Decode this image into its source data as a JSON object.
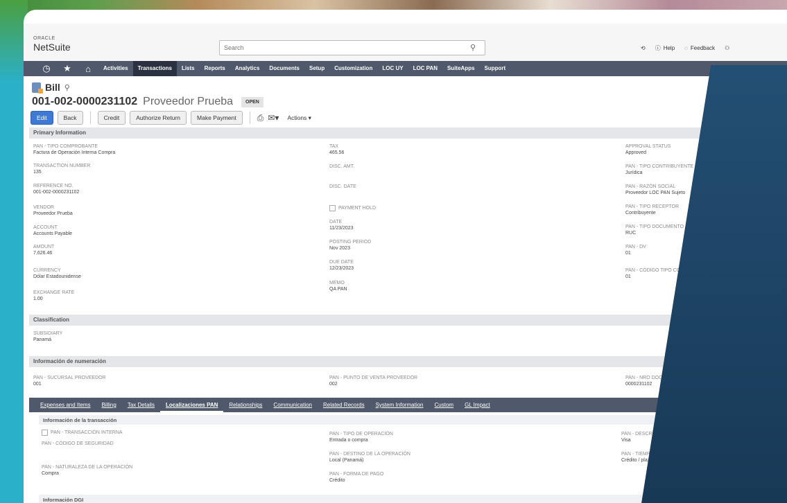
{
  "header": {
    "logo_small": "ORACLE",
    "logo_main": "NetSuite",
    "search_placeholder": "Search",
    "help": "Help",
    "feedback": "Feedback"
  },
  "nav": {
    "items": [
      "Activities",
      "Transactions",
      "Lists",
      "Reports",
      "Analytics",
      "Documents",
      "Setup",
      "Customization",
      "LOC UY",
      "LOC PAN",
      "SuiteApps",
      "Support"
    ],
    "active": "Transactions"
  },
  "record": {
    "type": "Bill",
    "number": "001-002-0000231102",
    "vendor_name": "Proveedor Prueba",
    "status": "OPEN"
  },
  "buttons": {
    "edit": "Edit",
    "back": "Back",
    "credit": "Credit",
    "authorize_return": "Authorize Return",
    "make_payment": "Make Payment",
    "actions": "Actions ▾"
  },
  "primary": {
    "title": "Primary Information",
    "col1": [
      {
        "label": "PAN - TIPO COMPROBANTE",
        "value": "Factura de Operación Interna Compra"
      },
      {
        "label": "TRANSACTION NUMBER",
        "value": "135"
      },
      {
        "label": "REFERENCE NO.",
        "value": "001-002-0000231102"
      },
      {
        "label": "VENDOR",
        "value": "Proveedor Prueba"
      },
      {
        "label": "ACCOUNT",
        "value": "Accounts Payable"
      },
      {
        "label": "AMOUNT",
        "value": "7,626.46"
      },
      {
        "label": "CURRENCY",
        "value": "Dólar Estadounidense"
      },
      {
        "label": "EXCHANGE RATE",
        "value": "1.00"
      }
    ],
    "col2_top": [
      {
        "label": "TAX",
        "value": "465.56"
      },
      {
        "label": "DISC. AMT.",
        "value": ""
      },
      {
        "label": "DISC. DATE",
        "value": ""
      }
    ],
    "payment_hold": "PAYMENT HOLD",
    "col2_bottom": [
      {
        "label": "DATE",
        "value": "11/23/2023"
      },
      {
        "label": "POSTING PERIOD",
        "value": "Nov 2023"
      },
      {
        "label": "DUE DATE",
        "value": "12/23/2023"
      },
      {
        "label": "MEMO",
        "value": "QA PAN"
      }
    ],
    "col3": [
      {
        "label": "APPROVAL STATUS",
        "value": "Approved"
      },
      {
        "label": "PAN - TIPO CONTRIBUYENTE",
        "value": "Jurídica"
      },
      {
        "label": "PAN - RAZÓN SOCIAL",
        "value": "Proveedor LOC PAN Sujeto"
      },
      {
        "label": "PAN - TIPO RECEPTOR",
        "value": "Contribuyente"
      },
      {
        "label": "PAN - TIPO DOCUMENTO",
        "value": "RUC"
      },
      {
        "label": "PAN - DV",
        "value": "01"
      },
      {
        "label": "PAN - CÓDIGO TIPO COMPROBANTE",
        "value": "01"
      }
    ]
  },
  "classification": {
    "title": "Classification",
    "subsidiary_label": "SUBSIDIARY",
    "subsidiary_value": "Panamá"
  },
  "numeracion": {
    "title": "Información de numeración",
    "f1": {
      "label": "PAN - SUCURSAL PROVEEDOR",
      "value": "001"
    },
    "f2": {
      "label": "PAN - PUNTO DE VENTA PROVEEDOR",
      "value": "002"
    },
    "f3": {
      "label": "PAN - NRO DOCUMENTO SECUENCIAL",
      "value": "0000231102"
    }
  },
  "tabs": {
    "items": [
      "Expenses and Items",
      "Billing",
      "Tax Details",
      "Localizaciones PAN",
      "Relationships",
      "Communication",
      "Related Records",
      "System Information",
      "Custom",
      "GL Impact"
    ],
    "active": "Localizaciones PAN"
  },
  "transaccion": {
    "title": "Información de la transacción",
    "interna": "PAN - TRANSACCIÓN INTERNA",
    "seguridad": "PAN - CÓDIGO DE SEGURIDAD",
    "naturaleza": {
      "label": "PAN - NATURALEZA DE LA OPERACIÓN",
      "value": "Compra"
    },
    "tipo_op": {
      "label": "PAN - TIPO DE OPERACIÓN",
      "value": "Entrada o compra"
    },
    "destino": {
      "label": "PAN - DESTINO DE LA OPERACIÓN",
      "value": "Local (Panamá)"
    },
    "forma_pago": {
      "label": "PAN - FORMA DE PAGO",
      "value": "Crédito"
    },
    "desc_forma": {
      "label": "PAN - DESCRIPCIÓN DE FORMA DE PAGO",
      "value": "Visa"
    },
    "tiempo": {
      "label": "PAN - TIEMPO DE PAGO",
      "value": "Crédito / plazo"
    }
  },
  "dgi": {
    "title": "Información DGI"
  }
}
